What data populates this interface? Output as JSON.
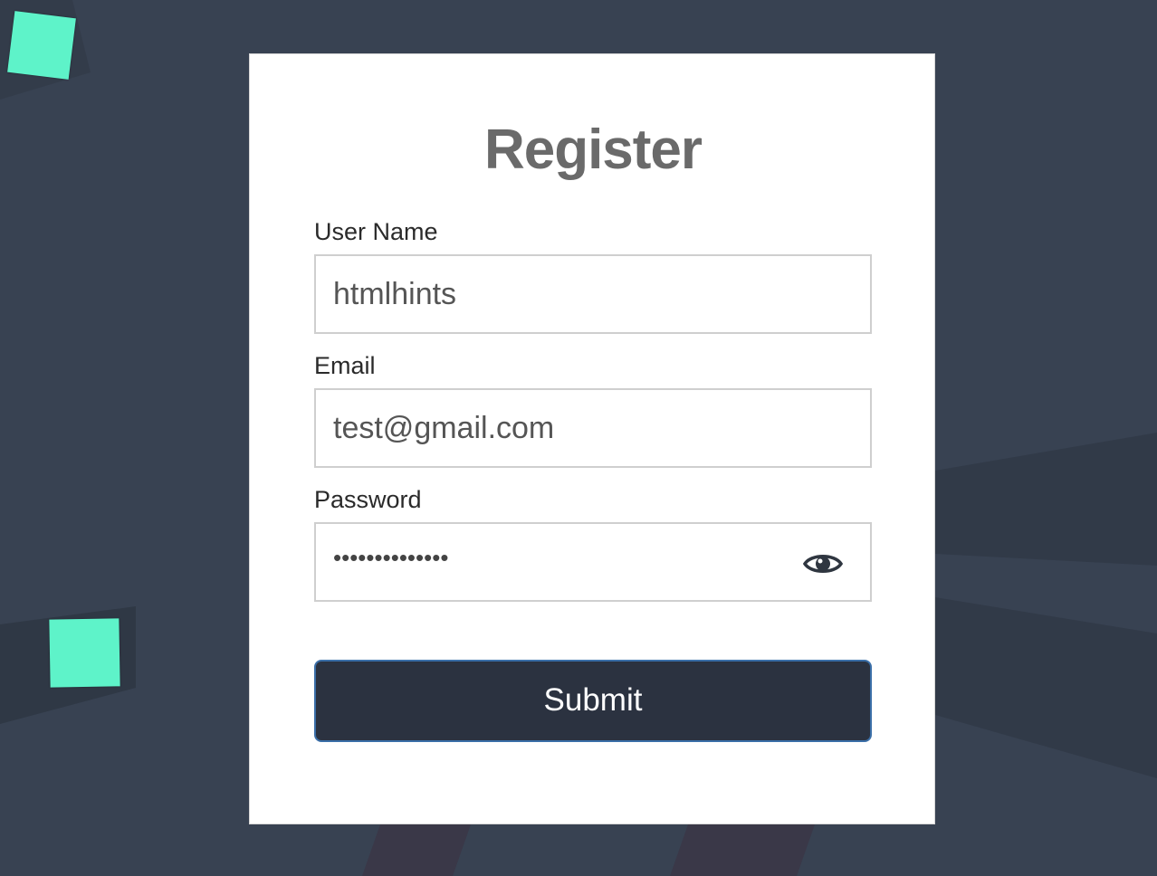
{
  "form": {
    "title": "Register",
    "username": {
      "label": "User Name",
      "value": "htmlhints"
    },
    "email": {
      "label": "Email",
      "value": "test@gmail.com"
    },
    "password": {
      "label": "Password",
      "value": "••••••••••••••",
      "toggle_icon": "eye-icon"
    },
    "submit_label": "Submit"
  },
  "colors": {
    "background": "#384252",
    "accent_square": "#5ef3c9",
    "button": "#2b3240"
  }
}
